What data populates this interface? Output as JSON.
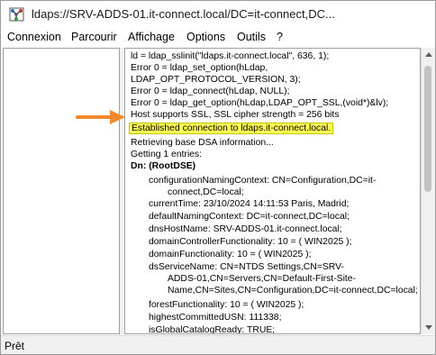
{
  "window": {
    "title": "ldaps://SRV-ADDS-01.it-connect.local/DC=it-connect,DC..."
  },
  "menu": [
    "Connexion",
    "Parcourir",
    "Affichage",
    "Options",
    "Outils",
    "?"
  ],
  "output": {
    "lines": [
      "ld = ldap_sslinit(\"ldaps.it-connect.local\", 636, 1);",
      "Error 0 = ldap_set_option(hLdap,",
      "LDAP_OPT_PROTOCOL_VERSION, 3);",
      "Error 0 = ldap_connect(hLdap, NULL);",
      "Error 0 = ldap_get_option(hLdap,LDAP_OPT_SSL,(void*)&lv);",
      "Host supports SSL, SSL cipher strength = 256 bits",
      "Established connection to ldaps.it-connect.local.",
      "Retrieving base DSA information...",
      "Getting 1 entries:",
      "Dn: (RootDSE)",
      "configurationNamingContext: CN=Configuration,DC=it-",
      "connect,DC=local;",
      "currentTime: 23/10/2024 14:11:53 Paris, Madrid;",
      "defaultNamingContext: DC=it-connect,DC=local;",
      "dnsHostName: SRV-ADDS-01.it-connect.local;",
      "domainControllerFunctionality: 10 = ( WIN2025 );",
      "domainFunctionality: 10 = ( WIN2025 );",
      "dsServiceName: CN=NTDS Settings,CN=SRV-",
      "ADDS-01,CN=Servers,CN=Default-First-Site-",
      "Name,CN=Sites,CN=Configuration,DC=it-connect,DC=local;",
      "forestFunctionality: 10 = ( WIN2025 );",
      "highestCommittedUSN: 111338;",
      "isGlobalCatalogReady: TRUE;"
    ]
  },
  "status": {
    "text": "Prêt"
  },
  "colors": {
    "highlight": "#ffff55",
    "annotation_arrow": "#f08a2c"
  },
  "icons": {
    "app": "ldp-app-icon",
    "annotation": "orange-arrow-icon"
  }
}
